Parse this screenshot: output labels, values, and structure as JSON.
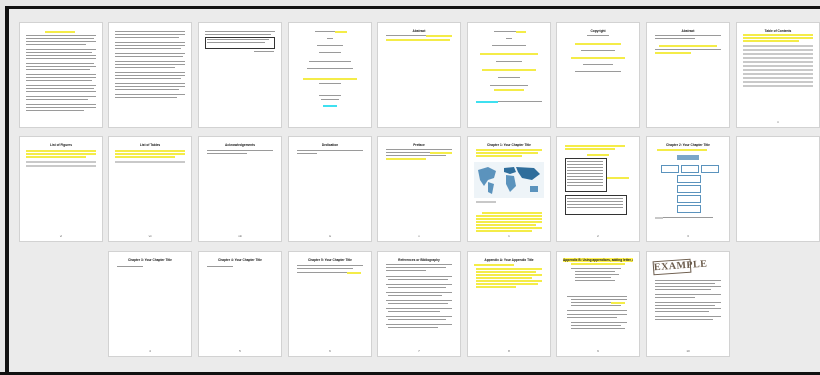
{
  "pages": [
    {
      "number": "",
      "title": ""
    },
    {
      "number": "",
      "title": ""
    },
    {
      "number": "",
      "title": ""
    },
    {
      "number": "",
      "title": ""
    },
    {
      "number": "",
      "title": "Abstract"
    },
    {
      "number": "",
      "title": ""
    },
    {
      "number": "",
      "title": "Copyright"
    },
    {
      "number": "",
      "title": "Abstract"
    },
    {
      "number": "ii",
      "title": "Table of Contents"
    },
    {
      "number": "vi",
      "title": "List of Figures"
    },
    {
      "number": "vii",
      "title": "List of Tables"
    },
    {
      "number": "viii",
      "title": "Acknowledgements"
    },
    {
      "number": "ix",
      "title": "Dedication"
    },
    {
      "number": "x",
      "title": "Preface"
    },
    {
      "number": "1",
      "title": "Chapter 1: Your Chapter Title"
    },
    {
      "number": "2",
      "title": ""
    },
    {
      "number": "3",
      "title": "Chapter 2: Your Chapter Title"
    },
    {
      "number": "",
      "title": ""
    },
    {
      "number": "4",
      "title": "Chapter 3: Your Chapter Title"
    },
    {
      "number": "5",
      "title": "Chapter 4: Your Chapter Title"
    },
    {
      "number": "6",
      "title": "Chapter 5: Your Chapter Title"
    },
    {
      "number": "7",
      "title": "References or Bibliography"
    },
    {
      "number": "8",
      "title": "Appendix A: Your Appendix Title"
    },
    {
      "number": "9",
      "title": "Appendix B: Using appendices, adding letter, adding numbers"
    },
    {
      "number": "10",
      "title": "EXAMPLE"
    }
  ]
}
